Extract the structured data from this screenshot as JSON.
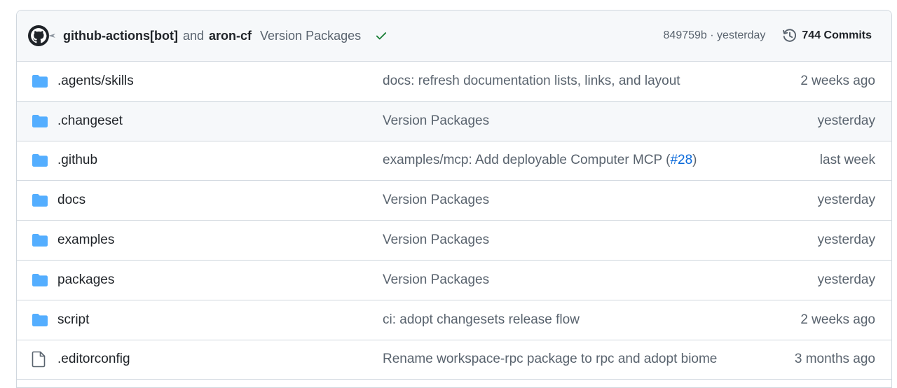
{
  "header": {
    "author1": "github-actions[bot]",
    "conjunction": "and",
    "author2": "aron-cf",
    "message": "Version Packages",
    "status_icon": "check-icon",
    "status_color": "#1a7f37",
    "sha_time": "849759b · yesterday",
    "commits_label": "744 Commits"
  },
  "rows": [
    {
      "name": ".agents/skills",
      "type": "folder",
      "commit": "docs: refresh documentation lists, links, and layout",
      "age": "2 weeks ago"
    },
    {
      "name": ".changeset",
      "type": "folder",
      "commit": "Version Packages",
      "age": "yesterday"
    },
    {
      "name": ".github",
      "type": "folder",
      "commit_pre": "examples/mcp: Add deployable Computer MCP (",
      "commit_link": "#28",
      "commit_post": ")",
      "age": "last week"
    },
    {
      "name": "docs",
      "type": "folder",
      "commit": "Version Packages",
      "age": "yesterday"
    },
    {
      "name": "examples",
      "type": "folder",
      "commit": "Version Packages",
      "age": "yesterday"
    },
    {
      "name": "packages",
      "type": "folder",
      "commit": "Version Packages",
      "age": "yesterday"
    },
    {
      "name": "script",
      "type": "folder",
      "commit": "ci: adopt changesets release flow",
      "age": "2 weeks ago"
    },
    {
      "name": ".editorconfig",
      "type": "file",
      "commit": "Rename workspace-rpc package to rpc and adopt biome",
      "age": "3 months ago"
    }
  ],
  "colors": {
    "folder": "#54aeff",
    "link": "#0969da",
    "muted": "#59636e",
    "border": "#d0d7de"
  }
}
